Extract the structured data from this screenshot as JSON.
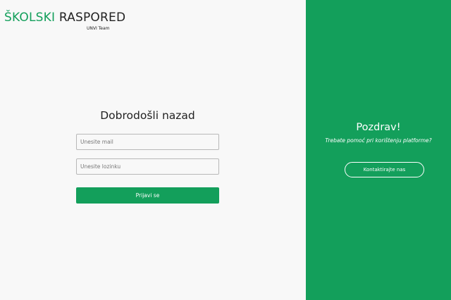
{
  "brand": {
    "name_part1": "ŠKOLSKI",
    "name_part2": "RASPORED",
    "subtitle": "UNVI Team"
  },
  "login": {
    "title": "Dobrodošli nazad",
    "email_placeholder": "Unesite mail",
    "email_value": "",
    "password_placeholder": "Unesite lozinku",
    "password_value": "",
    "submit_label": "Prijavi se"
  },
  "side_panel": {
    "title": "Pozdrav!",
    "subtitle": "Trebate pomoć pri korištenju platforme?",
    "contact_label": "Kontaktirajte nas"
  },
  "colors": {
    "accent": "#139f5b",
    "background": "#f8f8f8",
    "text_dark": "#222222",
    "text_on_accent": "#ffffff"
  }
}
